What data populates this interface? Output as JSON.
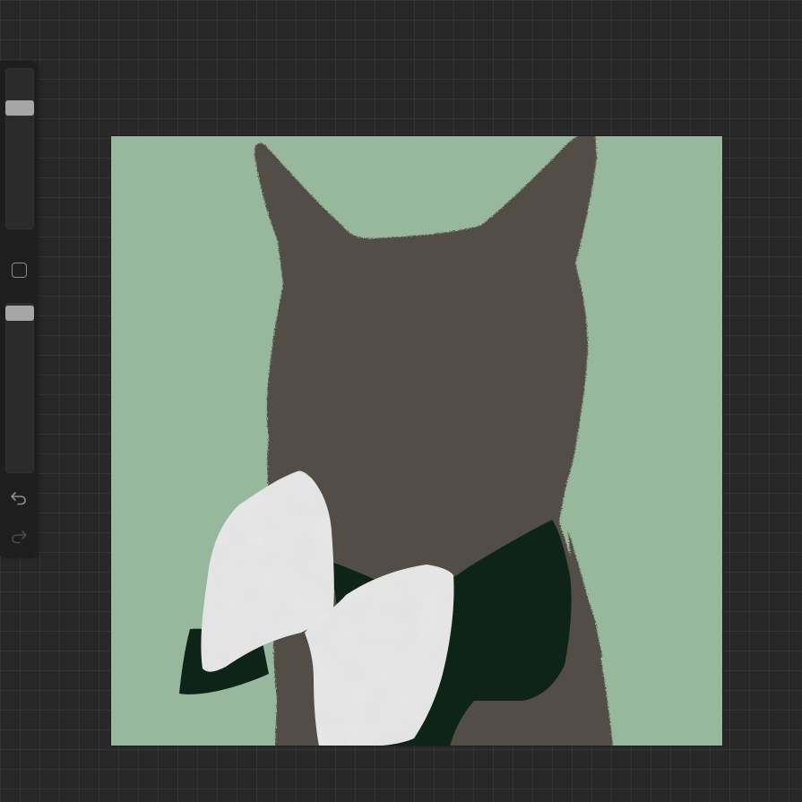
{
  "app": {
    "background_color": "#282828",
    "grid_color": "#3a3a3a"
  },
  "canvas": {
    "background_color": "#97b89c",
    "subject": {
      "cat_color": "#524d47",
      "bowtie_knot_color": "#0f2419",
      "bowtie_bow_color": "#e1e1e1"
    }
  },
  "sidebar": {
    "background_color": "#1e1e1e",
    "brush_size": {
      "level": 0.78,
      "thumb_color": "#a6a6a6"
    },
    "modify_button": {
      "icon": "square-icon"
    },
    "brush_opacity": {
      "level": 0.98,
      "thumb_color": "#a6a6a6"
    },
    "undo": {
      "icon": "undo-icon",
      "enabled": true
    },
    "redo": {
      "icon": "redo-icon",
      "enabled": false
    }
  }
}
